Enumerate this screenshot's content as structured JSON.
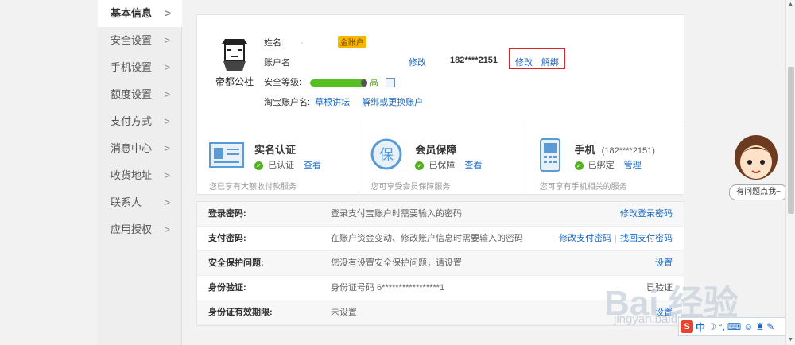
{
  "sidebar": {
    "items": [
      {
        "label": "基本信息",
        "arrow": ">"
      },
      {
        "label": "安全设置",
        "arrow": ">"
      },
      {
        "label": "手机设置",
        "arrow": ">"
      },
      {
        "label": "额度设置",
        "arrow": ">"
      },
      {
        "label": "支付方式",
        "arrow": ">"
      },
      {
        "label": "消息中心",
        "arrow": ">"
      },
      {
        "label": "收货地址",
        "arrow": ">"
      },
      {
        "label": "联系人",
        "arrow": ">"
      },
      {
        "label": "应用授权",
        "arrow": ">"
      }
    ]
  },
  "profile": {
    "avatar_text": "帝都公社",
    "name_label": "姓名:",
    "name_value": "·",
    "gold_badge": "金账户",
    "account_label": "账户名",
    "account_edit": "修改",
    "phone": "182****2151",
    "phone_edit": "修改",
    "phone_unbind": "解绑",
    "security_label": "安全等级:",
    "security_level_value": 0.95,
    "security_level_text": "高",
    "taobao_label": "淘宝账户名:",
    "taobao_value": "草根讲坛",
    "taobao_action": "解绑或更换账户"
  },
  "verify": [
    {
      "icon": "id-card-icon",
      "title": "实名认证",
      "extra": "",
      "status": "已认证",
      "link": "查看",
      "desc": "您已享有大额收付款服务"
    },
    {
      "icon": "shield-bao-icon",
      "title": "会员保障",
      "extra": "",
      "status": "已保障",
      "link": "查看",
      "desc": "您可享受会员保障服务"
    },
    {
      "icon": "mobile-phone-icon",
      "title": "手机",
      "extra": "(182****2151)",
      "status": "已绑定",
      "link": "管理",
      "desc": "您可享有手机相关的服务"
    }
  ],
  "security_rows": [
    {
      "label": "登录密码:",
      "desc": "登录支付宝账户时需要输入的密码",
      "actions": [
        "修改登录密码"
      ]
    },
    {
      "label": "支付密码:",
      "desc": "在账户资金变动、修改账户信息时需要输入的密码",
      "actions": [
        "修改支付密码",
        "找回支付密码"
      ]
    },
    {
      "label": "安全保护问题:",
      "desc": "您没有设置安全保护问题，请设置",
      "actions": [
        "设置"
      ]
    },
    {
      "label": "身份验证:",
      "desc": "身份证号码 6*****************1",
      "actions": [
        "已验证"
      ]
    },
    {
      "label": "身份证有效期限:",
      "desc": "未设置",
      "actions": [
        "设置"
      ]
    }
  ],
  "helper": {
    "bubble": "有问题点我~"
  },
  "watermark": {
    "main": "Bai 经验",
    "sub": "jingyan.baidu.com"
  },
  "ime": {
    "label": "中"
  },
  "colors": {
    "link": "#1a67c4",
    "check": "#55b022",
    "highlight_box": "#d9262c",
    "gold": "#f5b800"
  }
}
